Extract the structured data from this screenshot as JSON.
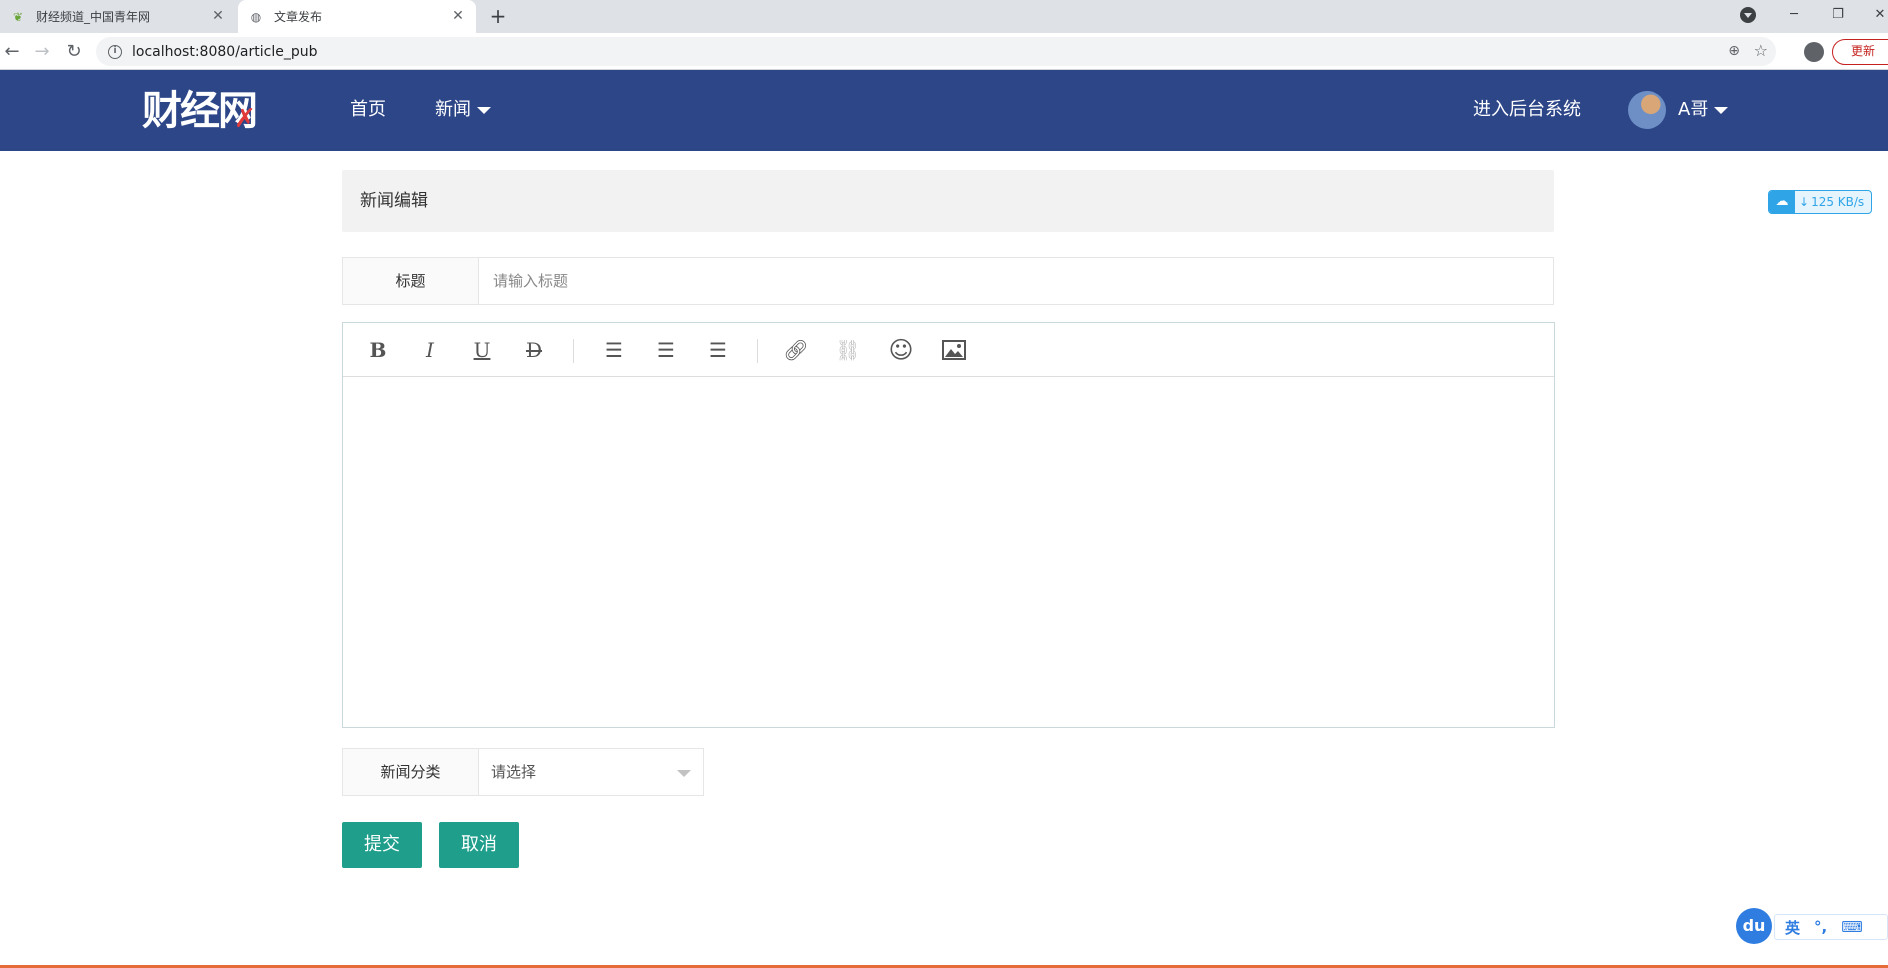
{
  "browser": {
    "tabs": [
      {
        "title": "财经频道_中国青年网",
        "active": false,
        "favicon": "kite-icon"
      },
      {
        "title": "文章发布",
        "active": true,
        "favicon": "globe-icon"
      }
    ],
    "url": "localhost:8080/article_pub",
    "update_label": "更新"
  },
  "site": {
    "logo_text": "财经网",
    "nav": {
      "home": "首页",
      "news": "新闻",
      "admin": "进入后台系统",
      "user": "A哥"
    },
    "brand_color": "#2d4688"
  },
  "form": {
    "panel_title": "新闻编辑",
    "title_label": "标题",
    "title_placeholder": "请输入标题",
    "category_label": "新闻分类",
    "category_placeholder": "请选择",
    "submit_label": "提交",
    "cancel_label": "取消",
    "button_color": "#1e9e8b"
  },
  "editor": {
    "toolbar": [
      "bold-icon",
      "italic-icon",
      "underline-icon",
      "strikethrough-icon",
      "align-left-icon",
      "align-center-icon",
      "align-right-icon",
      "link-icon",
      "unlink-icon",
      "emoji-icon",
      "image-icon"
    ]
  },
  "widgets": {
    "download_speed": "125 KB/s",
    "ime_logo": "du",
    "ime_lang": "英"
  }
}
